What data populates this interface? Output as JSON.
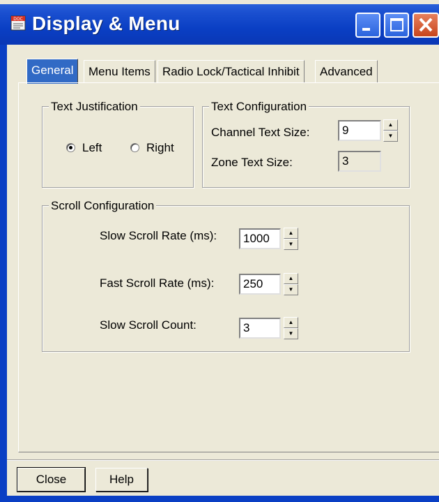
{
  "window": {
    "title": "Display & Menu",
    "icon": "doc-icon",
    "icon_text": "DOC"
  },
  "tabs": [
    {
      "label": "General",
      "active": true
    },
    {
      "label": "Menu Items",
      "active": false
    },
    {
      "label": "Radio Lock/Tactical Inhibit",
      "active": false
    },
    {
      "label": "Advanced",
      "active": false
    }
  ],
  "text_justification": {
    "title": "Text Justification",
    "left_label": "Left",
    "right_label": "Right",
    "selected": "Left"
  },
  "text_configuration": {
    "title": "Text Configuration",
    "channel_label": "Channel Text Size:",
    "channel_value": "9",
    "zone_label": "Zone Text Size:",
    "zone_value": "3"
  },
  "scroll_configuration": {
    "title": "Scroll Configuration",
    "slow_rate_label": "Slow Scroll Rate (ms):",
    "slow_rate_value": "1000",
    "fast_rate_label": "Fast Scroll Rate (ms):",
    "fast_rate_value": "250",
    "slow_count_label": "Slow Scroll Count:",
    "slow_count_value": "3"
  },
  "footer": {
    "close_label": "Close",
    "help_label": "Help"
  },
  "colors": {
    "titlebar": "#0a3fc4",
    "active_tab": "#316ac5",
    "dialog_bg": "#ece9d8"
  }
}
